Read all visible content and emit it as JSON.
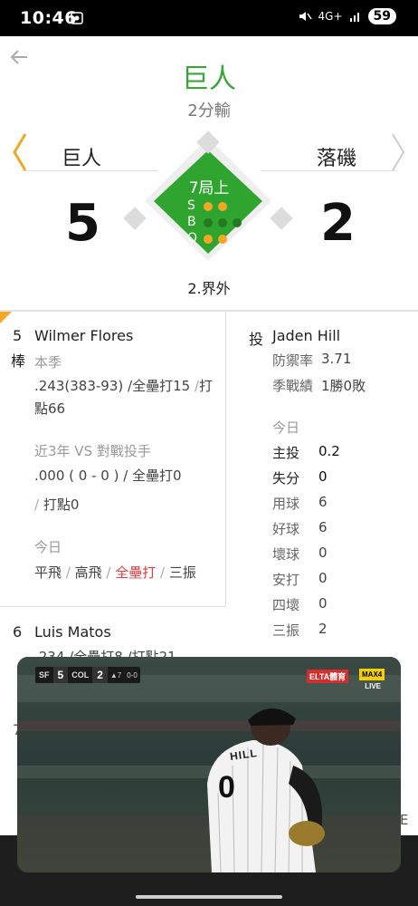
{
  "status_bar": {
    "time": "10:46",
    "network": "4G+",
    "battery": "59"
  },
  "header": {
    "title": "巨人",
    "result": "2分輸"
  },
  "scoreboard": {
    "away_team": "巨人",
    "home_team": "落磯",
    "away_score": "5",
    "home_score": "2",
    "inning": "7局上",
    "count_labels": {
      "s": "S",
      "b": "B",
      "o": "O"
    },
    "count_values": {
      "strikes": 2,
      "balls": 0,
      "outs": 2
    },
    "play": "2.界外"
  },
  "batter": {
    "order": "5",
    "role": "棒",
    "name": "Wilmer Flores",
    "season_label": "本季",
    "season_line1_a": ".243(383-93) /",
    "season_line1_b": "全壘打15",
    "season_line1_c": " /",
    "season_line1_d": "打",
    "season_line2": "點66",
    "vs_label": "近3年 VS 對戰投手",
    "vs_line1_a": ".000 ( 0 - 0 ) /",
    "vs_line1_b": " 全壘打0",
    "vs_line2_a": "/",
    "vs_line2_b": " 打點0",
    "today_label": "今日",
    "today_a": "平飛",
    "today_sep1": " / ",
    "today_b": "高飛",
    "today_sep2": " / ",
    "today_c": "全壘打",
    "today_sep3": " / ",
    "today_d": "三振"
  },
  "next_batter": {
    "order": "6",
    "name": "Luis Matos",
    "season_partial": ".234 /全壘打8 /打點21"
  },
  "third_order": "7",
  "pitcher": {
    "role": "投",
    "name": "Jaden Hill",
    "era_label": "防禦率",
    "era_value": "3.71",
    "record_label": "季戰績",
    "record_value": "1勝0敗",
    "today_label": "今日",
    "stats": [
      {
        "label": "主投",
        "value": "0.2"
      },
      {
        "label": "失分",
        "value": "0"
      },
      {
        "label": "用球",
        "value": "6"
      },
      {
        "label": "好球",
        "value": "6"
      },
      {
        "label": "壞球",
        "value": "0"
      },
      {
        "label": "安打",
        "value": "0"
      },
      {
        "label": "四壞",
        "value": "0"
      },
      {
        "label": "三振",
        "value": "2"
      }
    ]
  },
  "video": {
    "away_abbr": "SF",
    "away_score": "5",
    "home_abbr": "COL",
    "home_score": "2",
    "inning_small": "▲7",
    "count_small": "0-0",
    "broadcaster": "ELTA體育",
    "max_badge": "MAX4",
    "live": "LIVE",
    "jersey_name": "HILL",
    "jersey_number": "0"
  },
  "bottom_letter": "E",
  "colors": {
    "accent_green": "#3aa63a",
    "field_green": "#2fa52f",
    "orange": "#f5a623",
    "red": "#e04040"
  }
}
